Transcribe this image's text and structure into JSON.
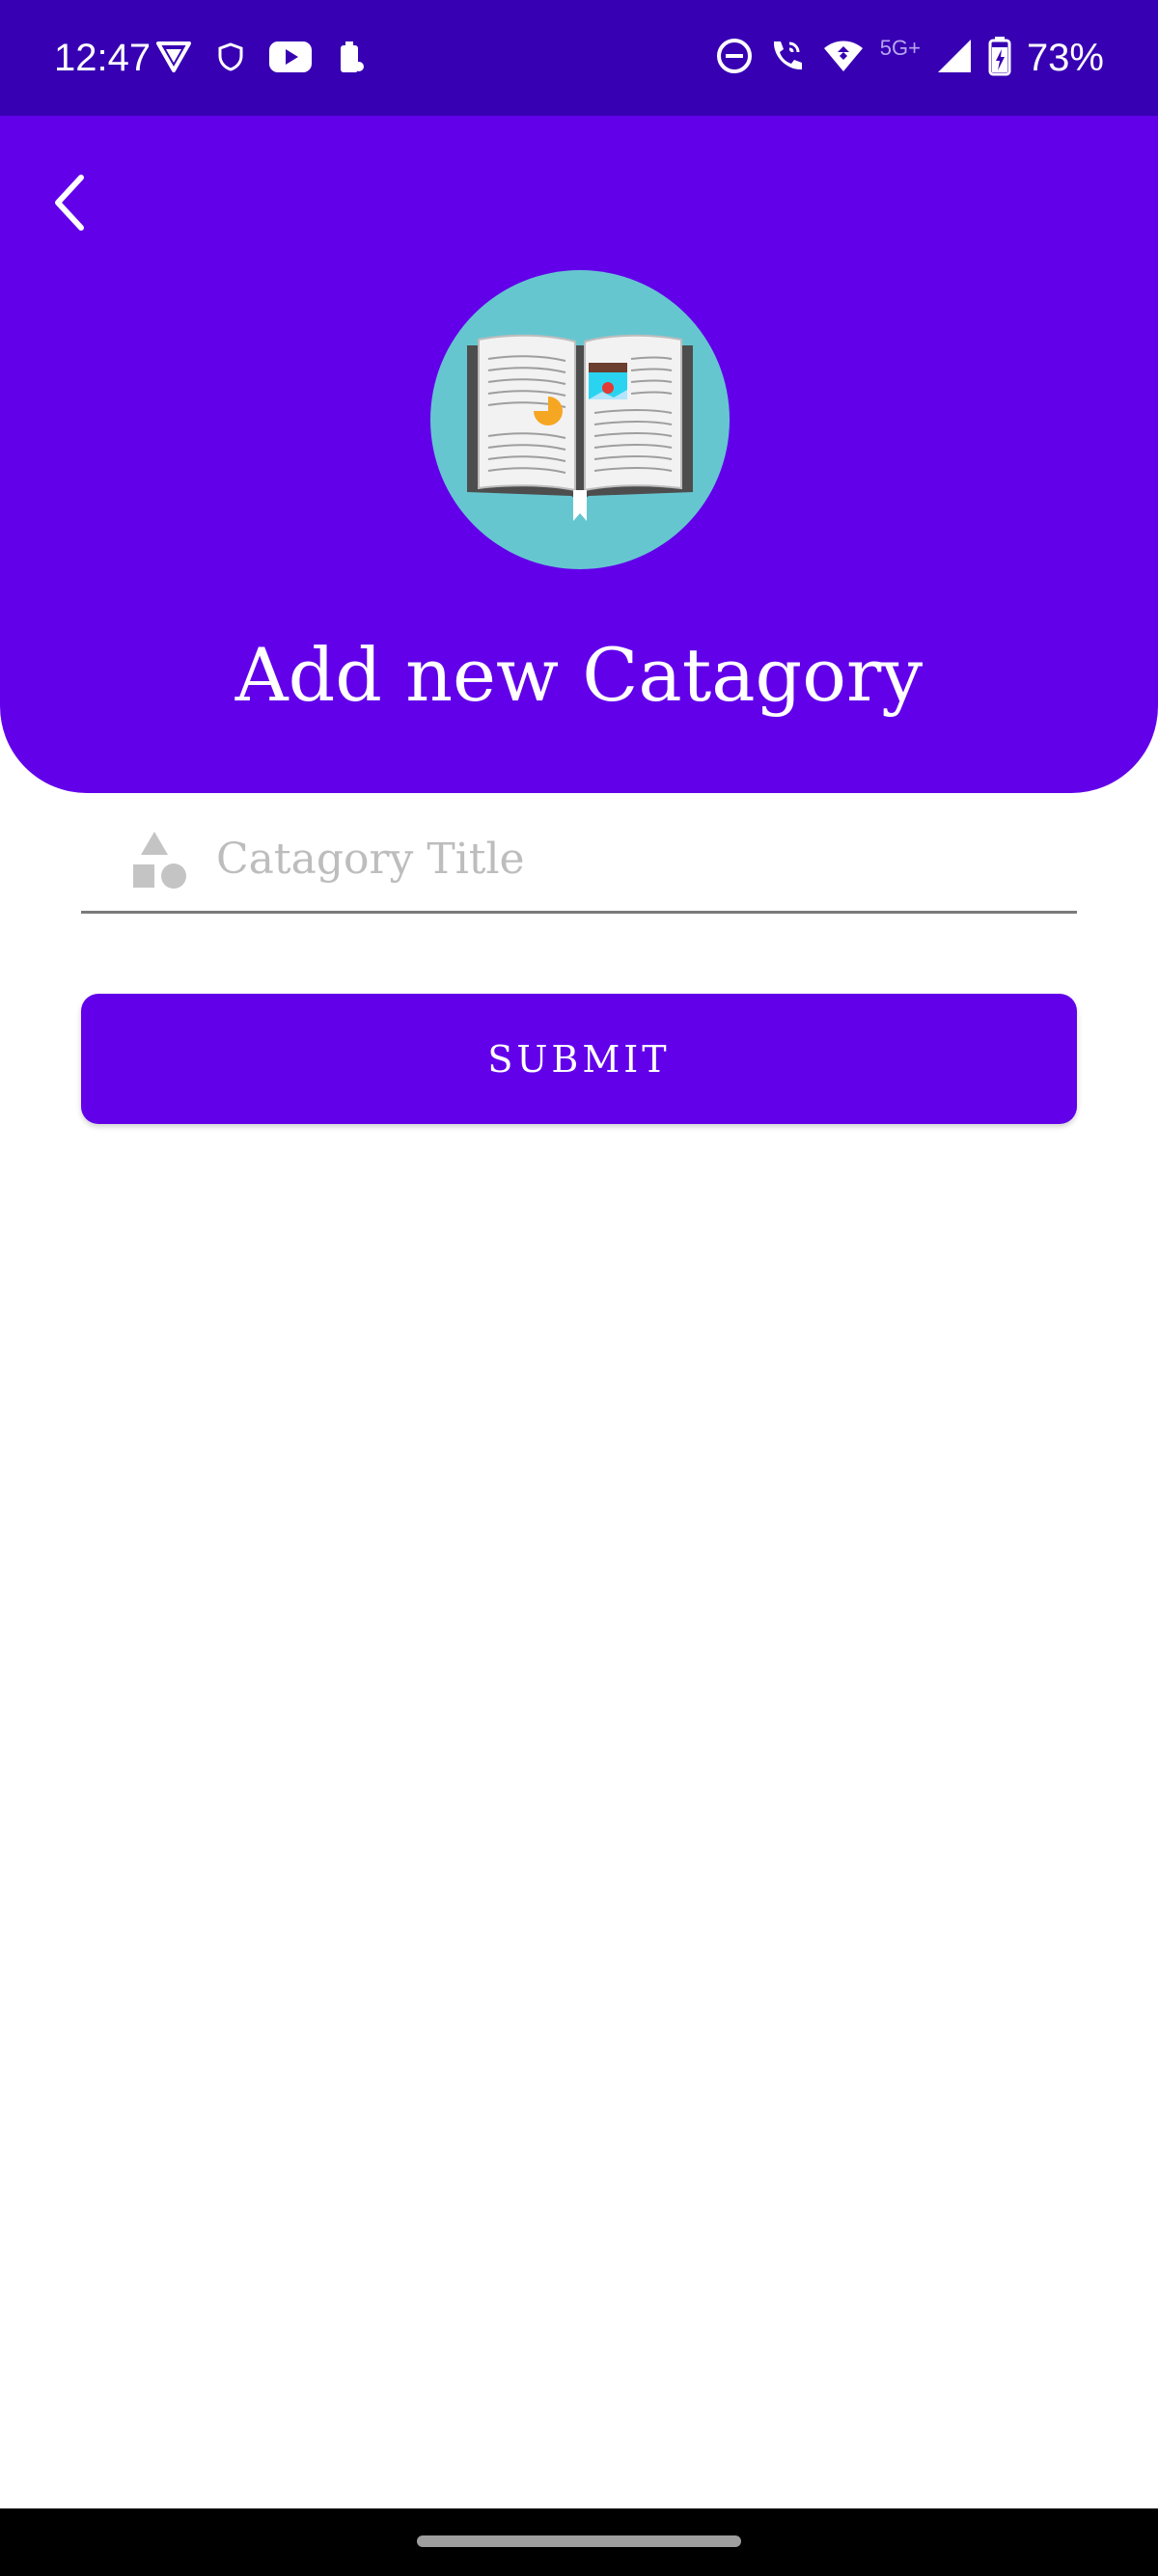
{
  "status_bar": {
    "time": "12:47",
    "network": "5G+",
    "battery": "73%",
    "left_icons": [
      "vpn-icon",
      "shield-icon",
      "youtube-icon",
      "battery-saver-icon"
    ],
    "right_icons": [
      "do-not-disturb-icon",
      "wifi-calling-icon",
      "wifi-icon",
      "cell-signal-icon",
      "battery-charging-icon"
    ]
  },
  "header": {
    "title": "Add new Catagory",
    "background_color": "#6200ea",
    "logo_icon": "open-book-icon",
    "logo_circle_color": "#66c6d0"
  },
  "form": {
    "category_title": {
      "placeholder": "Catagory Title",
      "value": "",
      "icon": "shapes-icon"
    },
    "submit_label": "SUBMIT"
  },
  "colors": {
    "primary": "#6200ea",
    "status_bar": "#3700b3"
  }
}
